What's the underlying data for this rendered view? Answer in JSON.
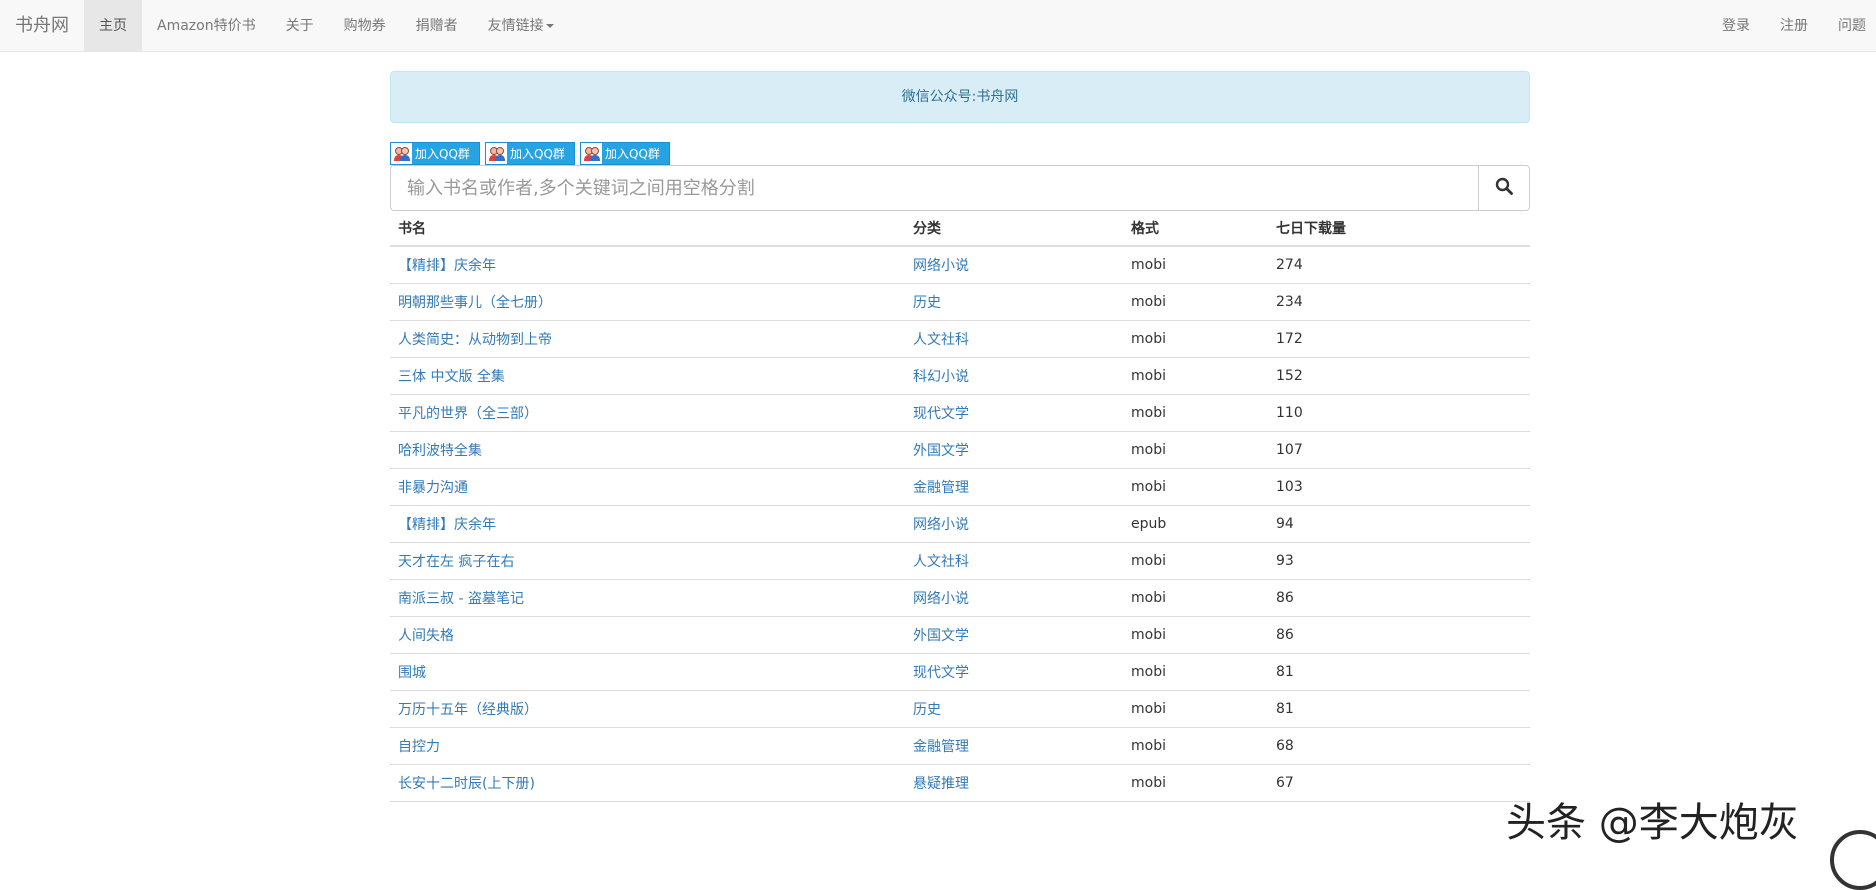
{
  "navbar": {
    "brand": "书舟网",
    "left_items": [
      {
        "label": "主页",
        "active": true
      },
      {
        "label": "Amazon特价书"
      },
      {
        "label": "关于"
      },
      {
        "label": "购物券"
      },
      {
        "label": "捐赠者"
      },
      {
        "label": "友情链接",
        "dropdown": true
      }
    ],
    "right_items": [
      {
        "label": "登录"
      },
      {
        "label": "注册"
      },
      {
        "label": "问题"
      }
    ]
  },
  "notice": {
    "text": "微信公众号:书舟网"
  },
  "qq_buttons": [
    {
      "label": "加入QQ群",
      "icon": "qq-group-icon"
    },
    {
      "label": "加入QQ群",
      "icon": "qq-group-icon"
    },
    {
      "label": "加入QQ群",
      "icon": "qq-group-icon"
    }
  ],
  "search": {
    "placeholder": "输入书名或作者,多个关键词之间用空格分割",
    "value": "",
    "button_icon": "search-icon"
  },
  "table": {
    "headers": [
      "书名",
      "分类",
      "格式",
      "七日下载量"
    ],
    "rows": [
      {
        "title": "【精排】庆余年",
        "category": "网络小说",
        "format": "mobi",
        "downloads": "274"
      },
      {
        "title": "明朝那些事儿（全七册）",
        "category": "历史",
        "format": "mobi",
        "downloads": "234"
      },
      {
        "title": "人类简史：从动物到上帝",
        "category": "人文社科",
        "format": "mobi",
        "downloads": "172"
      },
      {
        "title": "三体 中文版 全集",
        "category": "科幻小说",
        "format": "mobi",
        "downloads": "152"
      },
      {
        "title": "平凡的世界（全三部）",
        "category": "现代文学",
        "format": "mobi",
        "downloads": "110"
      },
      {
        "title": "哈利波特全集",
        "category": "外国文学",
        "format": "mobi",
        "downloads": "107"
      },
      {
        "title": "非暴力沟通",
        "category": "金融管理",
        "format": "mobi",
        "downloads": "103"
      },
      {
        "title": "【精排】庆余年",
        "category": "网络小说",
        "format": "epub",
        "downloads": "94"
      },
      {
        "title": "天才在左 疯子在右",
        "category": "人文社科",
        "format": "mobi",
        "downloads": "93"
      },
      {
        "title": "南派三叔 - 盗墓笔记",
        "category": "网络小说",
        "format": "mobi",
        "downloads": "86"
      },
      {
        "title": "人间失格",
        "category": "外国文学",
        "format": "mobi",
        "downloads": "86"
      },
      {
        "title": "围城",
        "category": "现代文学",
        "format": "mobi",
        "downloads": "81"
      },
      {
        "title": "万历十五年（经典版）",
        "category": "历史",
        "format": "mobi",
        "downloads": "81"
      },
      {
        "title": "自控力",
        "category": "金融管理",
        "format": "mobi",
        "downloads": "68"
      },
      {
        "title": "长安十二时辰(上下册)",
        "category": "悬疑推理",
        "format": "mobi",
        "downloads": "67"
      }
    ]
  },
  "watermark": {
    "text": "头条 @李大炮灰"
  },
  "colors": {
    "link": "#337ab7",
    "notice_bg": "#d9edf7",
    "notice_text": "#31708f",
    "qq_button": "#26a3e3",
    "navbar_bg": "#f8f8f8"
  }
}
